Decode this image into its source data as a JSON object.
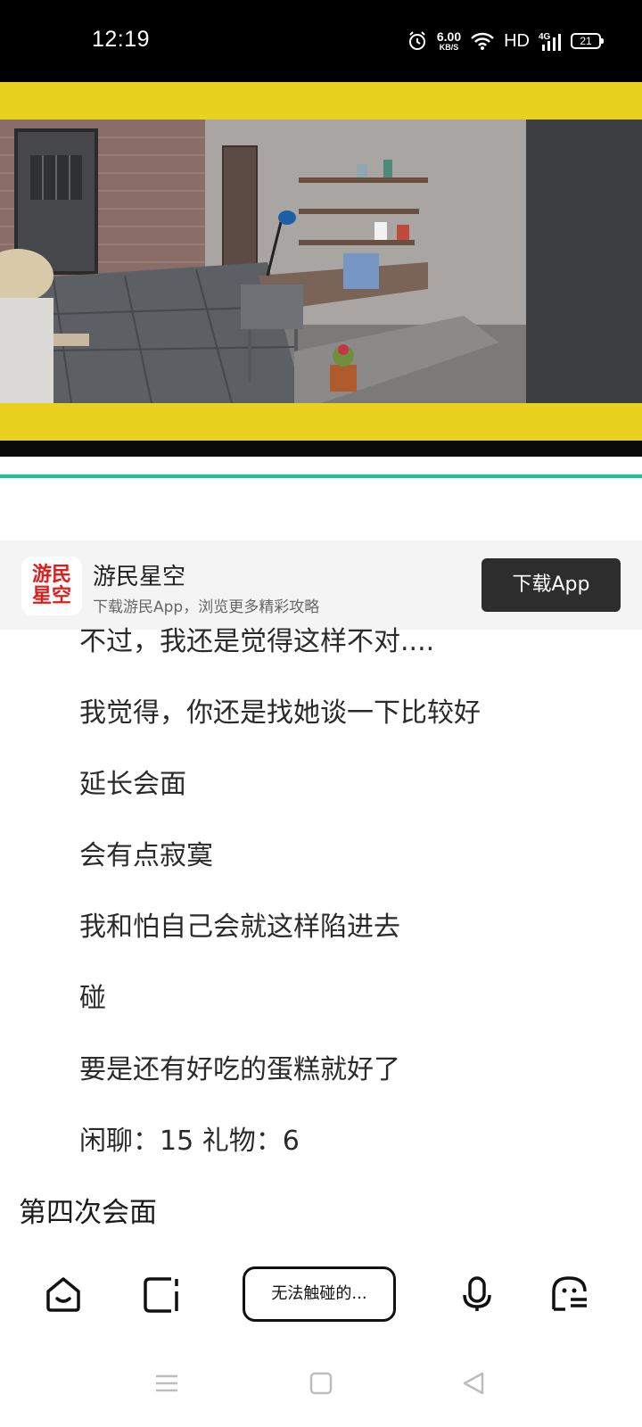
{
  "status_bar": {
    "time": "12:19",
    "net_speed_value": "6.00",
    "net_speed_unit": "KB/S",
    "hd_label": "HD",
    "network_label": "4G",
    "battery_level": "21"
  },
  "app_banner": {
    "logo_text_line1": "游民",
    "logo_text_line2": "星空",
    "app_name": "游民星空",
    "subtitle": "下载游民App，浏览更多精彩攻略",
    "download_button": "下载App"
  },
  "article": {
    "lines": [
      "不过，我还是觉得这样不对....",
      "我觉得，你还是找她谈一下比较好",
      "延长会面",
      "会有点寂寞",
      "我和怕自己会就这样陷进去",
      "碰",
      "要是还有好吃的蛋糕就好了",
      "闲聊：15 礼物：6"
    ],
    "section_heading": "第四次会面"
  },
  "toolbar": {
    "search_text": "无法触碰的...",
    "icons": [
      "home-icon",
      "tabs-icon",
      "mic-icon",
      "assistant-icon"
    ]
  },
  "navbar": {
    "icons": [
      "menu-icon",
      "home-square-icon",
      "back-icon"
    ]
  },
  "colors": {
    "accent_yellow": "#e9d21f",
    "accent_green": "#1fc48a",
    "brand_red": "#e01d1d"
  }
}
